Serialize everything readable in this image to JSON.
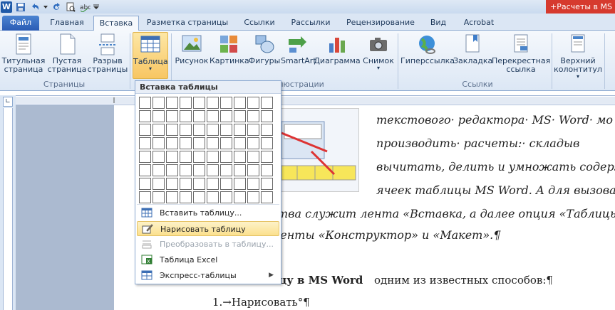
{
  "window": {
    "title": "+Расчеты в MS"
  },
  "tabs": [
    {
      "label": "Файл"
    },
    {
      "label": "Главная"
    },
    {
      "label": "Вставка"
    },
    {
      "label": "Разметка страницы"
    },
    {
      "label": "Ссылки"
    },
    {
      "label": "Рассылки"
    },
    {
      "label": "Рецензирование"
    },
    {
      "label": "Вид"
    },
    {
      "label": "Acrobat"
    }
  ],
  "ribbon": {
    "buttons": {
      "title_page": "Титульная страница",
      "blank_page": "Пустая страница",
      "page_break": "Разрыв страницы",
      "table": "Таблица",
      "picture": "Рисунок",
      "clipart": "Картинка",
      "shapes": "Фигуры",
      "smartart": "SmartArt",
      "chart": "Диаграмма",
      "screenshot": "Снимок",
      "hyperlink": "Гиперссылка",
      "bookmark": "Закладка",
      "crossref": "Перекрестная ссылка",
      "header": "Верхний колонтитул"
    },
    "groups": {
      "pages": "Страницы",
      "illustrations": "Иллюстрации",
      "links": "Ссылки"
    }
  },
  "dropdown": {
    "header": "Вставка таблицы",
    "items": [
      {
        "label": "Вставить таблицу..."
      },
      {
        "label": "Нарисовать таблицу"
      },
      {
        "label": "Преобразовать в таблицу..."
      },
      {
        "label": "Таблица Excel"
      },
      {
        "label": "Экспресс-таблицы"
      }
    ]
  },
  "document": {
    "lines": [
      "текстового· редактора· MS· Word· мо",
      "производить·      расчеты:·      складыв",
      "вычитать, делить и умножать содержи",
      "ячеек таблицы MS Word. А для вызова в",
      "ства служит лента «Вставка, а далее опция «Таблицы»",
      "менты «Конструктор» и «Макет».¶",
      "ицу в MS Word",
      " одним из известных способов:¶",
      "1.→Нарисовать°¶"
    ]
  },
  "colors": {
    "accent": "#2a5bb4",
    "title_red": "#d63a2e",
    "highlight": "#fbe08d"
  }
}
